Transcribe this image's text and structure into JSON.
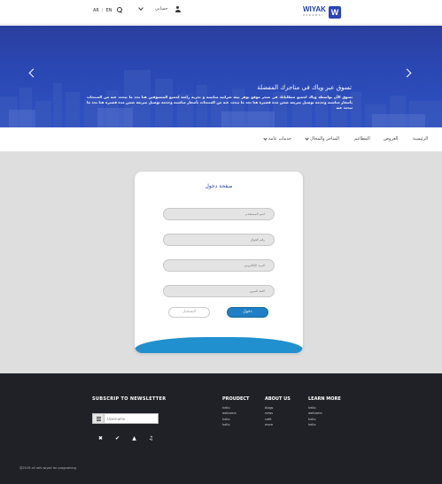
{
  "header": {
    "lang_ar": "AR",
    "lang_sep": "|",
    "lang_en": "EN",
    "account_label": "حسابي",
    "logo_text": "WIYAK",
    "logo_sub": "O P E N   W A Y",
    "logo_mark": "W"
  },
  "hero": {
    "title": "تسوق عبر وياك في متاجرك المفضلة",
    "description": "تسوق الآن بواسطة وياك لجميع متطلباتك في متجر موقع يوفر بيئة شرائية مناسبة و تجربة رائعة لجميع المتسوقين هنا تجد ما تبحث عنه من المنتجات بأسعار مناسبة وخدمة توصيل سريعة ضمن مدة قصيرة هنا تجد ما تبحث عنه من المنتجات بأسعار مناسبة وخدمة توصيل سريعة ضمن مدة قصيرة هنا تجد ما تبحث عنه",
    "slide_count": 3,
    "active_slide": 2
  },
  "nav": {
    "home": "الرئيسية",
    "offers": "العروض",
    "restaurants": "المطاعم",
    "stores": "المتاجر والمحال",
    "services": "خدمات عامة"
  },
  "login_card": {
    "title": "صفحة دخول",
    "name_placeholder": "اسم المستخدم",
    "phone_placeholder": "رقم الجوال",
    "email_placeholder": "البريد الإلكتروني",
    "password_placeholder": "كلمة المرور",
    "login_button": "دخول",
    "register_button": "التسجيل"
  },
  "footer": {
    "newsletter_title": "SUBSCRIP TO NEWSLETTER",
    "newsletter_placeholder": "Username",
    "columns": [
      {
        "title": "PROUDECT",
        "links": [
          "hello",
          "welcome",
          "hello",
          "hello"
        ]
      },
      {
        "title": "ABOUT US",
        "links": [
          "blogs",
          "news",
          "café",
          "more"
        ]
      },
      {
        "title": "LEARN MORE",
        "links": [
          "hello",
          "welcome",
          "hello",
          "hello"
        ]
      }
    ],
    "copyright": "@2019 all rofs wiyak for programing"
  },
  "colors": {
    "brand_blue": "#2b44b5",
    "hero_blue": "#2a47b2",
    "button_blue": "#1f7fc4",
    "footer_bg": "#202127",
    "main_bg": "#dedede"
  }
}
